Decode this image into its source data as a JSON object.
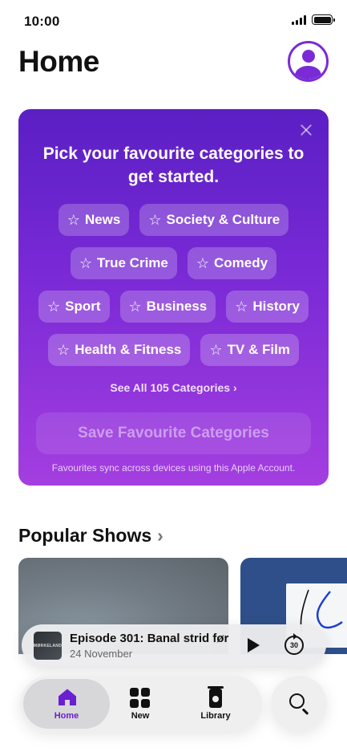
{
  "status_bar": {
    "time": "10:00"
  },
  "header": {
    "title": "Home"
  },
  "categories_card": {
    "heading": "Pick your favourite categories to get started.",
    "rows": [
      [
        "News",
        "Society & Culture"
      ],
      [
        "True Crime",
        "Comedy"
      ],
      [
        "Sport",
        "Business",
        "History"
      ],
      [
        "Health & Fitness",
        "TV & Film"
      ]
    ],
    "see_all": "See All 105 Categories ›",
    "save_label": "Save Favourite Categories",
    "sync_note": "Favourites sync across devices using this Apple Account."
  },
  "popular": {
    "title": "Popular Shows",
    "chevron": "›",
    "tile1_art_text": ""
  },
  "mini_player": {
    "art_text": "MØRKELAND",
    "title": "Episode 301: Banal strid før",
    "date": "24 November",
    "skip_label": "30"
  },
  "tabbar": {
    "home": "Home",
    "new": "New",
    "library": "Library"
  },
  "colors": {
    "accent": "#6a1fd0",
    "card_top": "#5a1fc4",
    "card_bottom": "#a43ee0"
  }
}
